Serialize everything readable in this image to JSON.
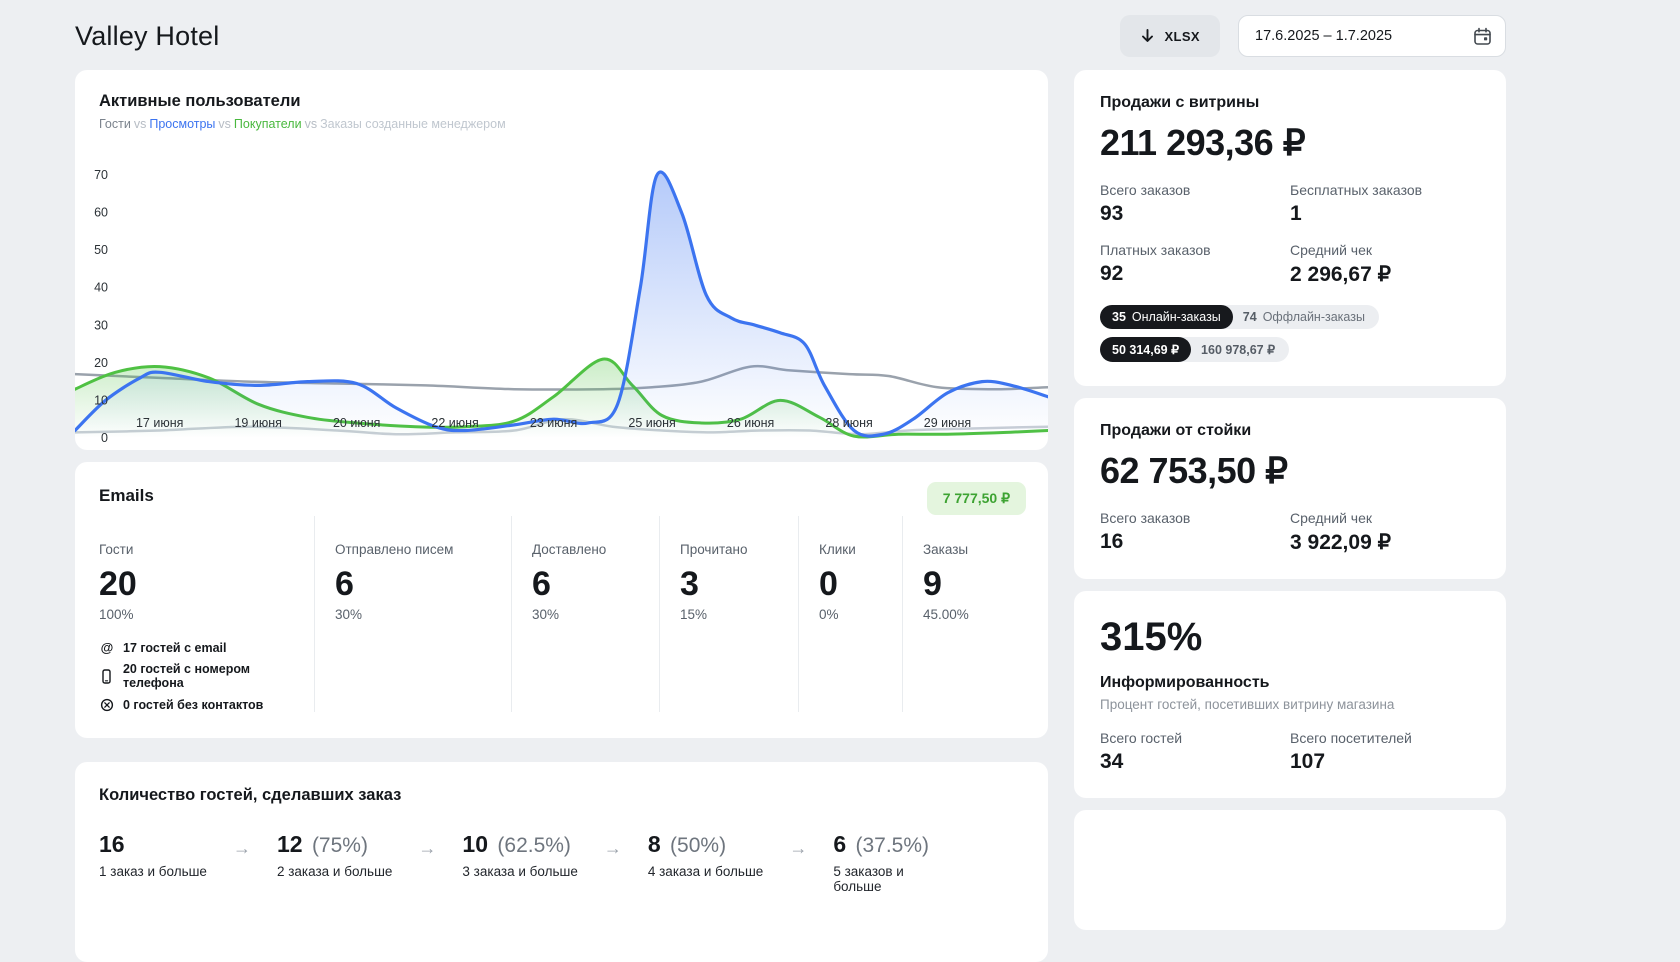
{
  "page": {
    "title": "Valley Hotel",
    "bg": "#edeff2"
  },
  "toolbar": {
    "xlsx_label": "XLSX",
    "date_range": "17.6.2025 – 1.7.2025"
  },
  "chart_card": {
    "title": "Активные пользователи",
    "vs": "vs",
    "legend": [
      {
        "label": "Гости",
        "color": "#7b838d"
      },
      {
        "label": "Просмотры",
        "color": "#3c74f0"
      },
      {
        "label": "Покупатели",
        "color": "#49b83e"
      },
      {
        "label": "Заказы созданные менеджером",
        "color": "#c0c7cf"
      }
    ]
  },
  "chart_data": {
    "type": "line",
    "title": "Активные пользователи",
    "ylim": [
      0,
      70
    ],
    "y_ticks": [
      0,
      10,
      20,
      30,
      40,
      50,
      60,
      70
    ],
    "t_domain": [
      -0.86,
      9.02
    ],
    "x_label_t": [
      0,
      1,
      2,
      3,
      4,
      5,
      6,
      7,
      8
    ],
    "x_labels": [
      "17 июня",
      "19 июня",
      "20 июня",
      "22 июня",
      "23 июня",
      "25 июня",
      "26 июня",
      "28 июня",
      "29 июня"
    ],
    "grid": false,
    "legend_position": "top-left",
    "series": [
      {
        "name": "Гости",
        "color": "#9aa2ac",
        "width": 2.5,
        "fill": null,
        "points": [
          [
            -0.86,
            17
          ],
          [
            0,
            16
          ],
          [
            0.9,
            15
          ],
          [
            1.8,
            14.5
          ],
          [
            2.7,
            14
          ],
          [
            3.6,
            13
          ],
          [
            4.5,
            13
          ],
          [
            5,
            13.5
          ],
          [
            5.5,
            15
          ],
          [
            6,
            19
          ],
          [
            6.4,
            18
          ],
          [
            7,
            17
          ],
          [
            7.4,
            16.5
          ],
          [
            7.9,
            13.5
          ],
          [
            8.5,
            13
          ],
          [
            9.02,
            13.5
          ]
        ]
      },
      {
        "name": "Заказы созданные менеджером",
        "color": "#c8ced6",
        "width": 2.5,
        "fill": null,
        "points": [
          [
            -0.86,
            1.5
          ],
          [
            0,
            2
          ],
          [
            0.9,
            3
          ],
          [
            1.8,
            2
          ],
          [
            2.4,
            1
          ],
          [
            3,
            1.5
          ],
          [
            3.6,
            2
          ],
          [
            4.1,
            5
          ],
          [
            4.6,
            3
          ],
          [
            5.1,
            2
          ],
          [
            5.6,
            1.5
          ],
          [
            6.1,
            2
          ],
          [
            6.6,
            2
          ],
          [
            7.1,
            1
          ],
          [
            7.6,
            2
          ],
          [
            8.2,
            2.5
          ],
          [
            9.02,
            3
          ]
        ]
      },
      {
        "name": "Покупатели",
        "color": "#4fc143",
        "width": 3,
        "fill": "green",
        "points": [
          [
            -0.86,
            13
          ],
          [
            -0.45,
            17.5
          ],
          [
            0,
            19
          ],
          [
            0.5,
            16
          ],
          [
            1,
            9
          ],
          [
            1.5,
            5.5
          ],
          [
            2,
            4
          ],
          [
            2.6,
            3
          ],
          [
            3.1,
            3
          ],
          [
            3.6,
            4.5
          ],
          [
            4,
            11
          ],
          [
            4.5,
            21
          ],
          [
            4.8,
            14
          ],
          [
            5.1,
            6
          ],
          [
            5.5,
            4
          ],
          [
            5.9,
            5
          ],
          [
            6.3,
            10
          ],
          [
            6.7,
            5.5
          ],
          [
            7.05,
            0.5
          ],
          [
            7.5,
            1
          ],
          [
            8,
            1
          ],
          [
            8.6,
            1.5
          ],
          [
            9.02,
            2
          ]
        ]
      },
      {
        "name": "Просмотры",
        "color": "#3c74f0",
        "width": 3.2,
        "fill": "blue",
        "points": [
          [
            -0.86,
            2
          ],
          [
            -0.55,
            10
          ],
          [
            -0.2,
            16
          ],
          [
            0,
            17.5
          ],
          [
            0.5,
            15
          ],
          [
            1,
            14
          ],
          [
            1.5,
            15
          ],
          [
            2,
            14.5
          ],
          [
            2.4,
            8
          ],
          [
            2.8,
            3
          ],
          [
            3.1,
            2
          ],
          [
            3.6,
            3.5
          ],
          [
            4,
            5
          ],
          [
            4.35,
            4
          ],
          [
            4.65,
            9
          ],
          [
            4.88,
            40
          ],
          [
            5.05,
            70
          ],
          [
            5.3,
            60
          ],
          [
            5.55,
            38
          ],
          [
            5.8,
            32
          ],
          [
            6.05,
            30
          ],
          [
            6.3,
            28
          ],
          [
            6.55,
            25
          ],
          [
            6.75,
            14
          ],
          [
            7.05,
            2
          ],
          [
            7.35,
            1
          ],
          [
            7.65,
            5
          ],
          [
            8,
            12
          ],
          [
            8.35,
            15
          ],
          [
            8.65,
            14
          ],
          [
            9.02,
            11
          ]
        ]
      }
    ]
  },
  "emails_card": {
    "title": "Emails",
    "orders_badge": "7 777,50 ₽",
    "columns": [
      {
        "label": "Гости",
        "value": "20",
        "percent": "100%"
      },
      {
        "label": "Отправлено писем",
        "value": "6",
        "percent": "30%"
      },
      {
        "label": "Доставлено",
        "value": "6",
        "percent": "30%"
      },
      {
        "label": "Прочитано",
        "value": "3",
        "percent": "15%"
      },
      {
        "label": "Клики",
        "value": "0",
        "percent": "0%"
      },
      {
        "label": "Заказы",
        "value": "9",
        "percent": "45.00%"
      }
    ],
    "contacts": [
      {
        "icon": "at-icon",
        "text": "17 гостей с email"
      },
      {
        "icon": "phone-icon",
        "text": "20 гостей с номером телефона"
      },
      {
        "icon": "no-contact-icon",
        "text": "0 гостей без контактов"
      }
    ]
  },
  "funnel_card": {
    "title": "Количество гостей, сделавших заказ",
    "arrow": "→",
    "steps": [
      {
        "value": "16",
        "percent": "",
        "label": "1 заказ и больше"
      },
      {
        "value": "12",
        "percent": "(75%)",
        "label": "2 заказа и больше"
      },
      {
        "value": "10",
        "percent": "(62.5%)",
        "label": "3 заказа и больше"
      },
      {
        "value": "8",
        "percent": "(50%)",
        "label": "4 заказа и больше"
      },
      {
        "value": "6",
        "percent": "(37.5%)",
        "label": "5 заказов и больше"
      }
    ]
  },
  "storefront_card": {
    "title": "Продажи с витрины",
    "total": "211 293,36 ₽",
    "stats": [
      {
        "label": "Всего заказов",
        "value": "93"
      },
      {
        "label": "Бесплатных заказов",
        "value": "1"
      },
      {
        "label": "Платных заказов",
        "value": "92"
      },
      {
        "label": "Средний чек",
        "value": "2 296,67 ₽"
      }
    ],
    "orders_split": {
      "dark_value": "35",
      "dark_label": "Онлайн-заказы",
      "light_value": "74",
      "light_label": "Оффлайн-заказы"
    },
    "revenue_split": {
      "dark_value": "50 314,69 ₽",
      "light_value": "160 978,67 ₽"
    }
  },
  "desk_card": {
    "title": "Продажи от стойки",
    "total": "62 753,50 ₽",
    "stats": [
      {
        "label": "Всего заказов",
        "value": "16"
      },
      {
        "label": "Средний чек",
        "value": "3 922,09 ₽"
      }
    ]
  },
  "awareness_card": {
    "value": "315%",
    "title": "Информированность",
    "subtitle": "Процент гостей, посетивших витрину магазина",
    "stats": [
      {
        "label": "Всего гостей",
        "value": "34"
      },
      {
        "label": "Всего посетителей",
        "value": "107"
      }
    ]
  }
}
